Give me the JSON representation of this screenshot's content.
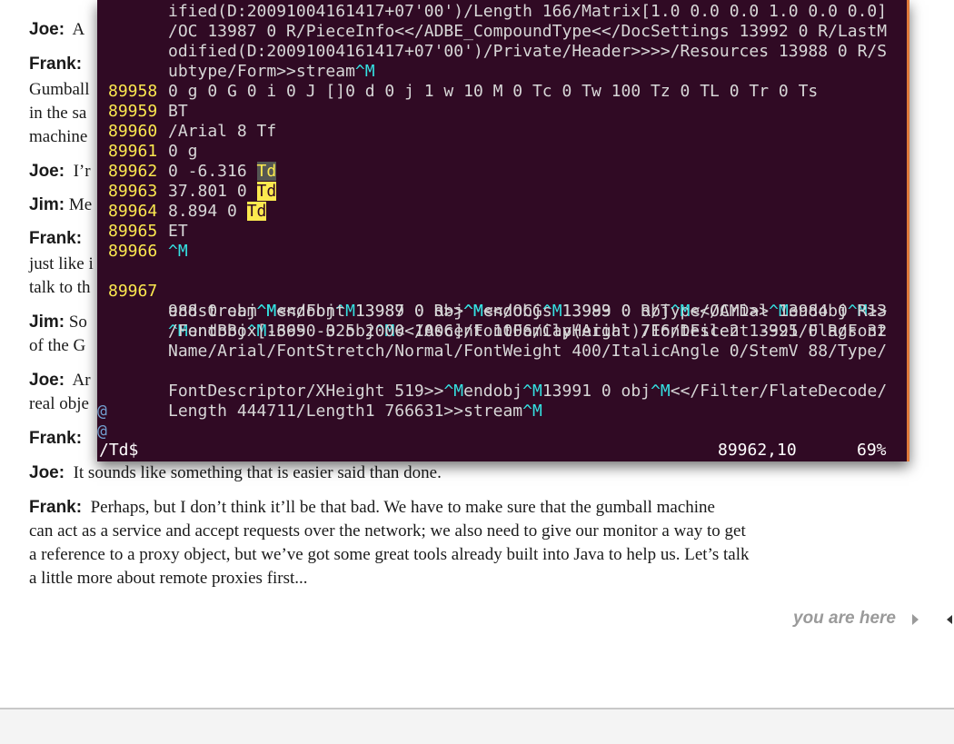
{
  "book": {
    "paragraphs": [
      {
        "speaker": "Joe",
        "sep": ":",
        "line1": "A"
      },
      {
        "speaker": "Frank",
        "sep": ":",
        "line1": "",
        "lines": [
          "Gumball",
          "in the sa",
          "machine"
        ]
      },
      {
        "speaker": "Joe",
        "sep": ":",
        "line1": "I’r"
      },
      {
        "speaker": "Jim",
        "sep": ":",
        "line1": "Me"
      },
      {
        "speaker": "Frank",
        "sep": ":",
        "line1": "",
        "lines": [
          "just like i",
          "talk to th"
        ]
      },
      {
        "speaker": "Jim:",
        "sep": "",
        "line1": "So",
        "lines": [
          "of the G"
        ]
      },
      {
        "speaker": "Joe",
        "sep": ":",
        "line1": "Ar",
        "lines": [
          "real obje"
        ]
      },
      {
        "speaker": "Frank",
        "sep": ":",
        "line1": ""
      },
      {
        "speaker": "Joe",
        "sep": ":",
        "line1": "It sounds like something that is easier said than done."
      },
      {
        "speaker": "Frank",
        "sep": ":",
        "line1": "Perhaps, but I don’t think it’ll be that bad.  We have to make sure that the gumball machine",
        "lines": [
          "can act as a service and accept requests over the network; we also need to give our monitor a way to get",
          "a reference to a proxy object, but we’ve got some great tools already built into Java to help us. Let’s talk",
          "a little more about remote proxies first..."
        ]
      }
    ],
    "footer": {
      "you_are_here": "you are here"
    }
  },
  "terminal": {
    "cont_lines": [
      "ified(D:20091004161417+07'00')/Length 166/Matrix[1.0 0.0 0.0 1.0 0.0 0.0]",
      "/OC 13987 0 R/PieceInfo<</ADBE_CompoundType<</DocSettings 13992 0 R/LastM",
      "odified(D:20091004161417+07'00')/Private/Header>>>>/Resources 13988 0 R/S",
      "ubtype/Form>>stream"
    ],
    "ctrl_m": "^M",
    "lines": [
      {
        "num": "89958",
        "text": "0 g 0 G 0 i 0 J []0 d 0 j 1 w 10 M 0 Tc 0 Tw 100 Tz 0 TL 0 Tr 0 Ts"
      },
      {
        "num": "89959",
        "text": "BT"
      },
      {
        "num": "89960",
        "text": "/Arial 8 Tf"
      },
      {
        "num": "89961",
        "text": "0 g"
      },
      {
        "num": "89962",
        "text": "0 -6.316 ",
        "match": "Td"
      },
      {
        "num": "89963",
        "text": "37.801 0 ",
        "match": "Td"
      },
      {
        "num": "89964",
        "text": "8.894 0 ",
        "match": "Td"
      },
      {
        "num": "89965",
        "text": "ET"
      },
      {
        "num": "89966",
        "text": ""
      },
      {
        "num": "89967",
        "text": "endstream"
      }
    ],
    "l67_rest": [
      "endobj",
      "13987 0 obj",
      "<</OCGs 13993 0 R/Type/OCMD>>",
      "endobj",
      "13",
      "988 0 obj",
      "<</Font 13989 0 R>>",
      "endobj",
      "13989 0 obj",
      "<</Arial 13984 0 R>>",
      "endobj",
      "13990 0 obj",
      "<</Ascent 1006/CapHeight 716/Descent -325/Flags 32",
      "/FontBBox[-665 -325 2000 1006]/FontFamily(Arial)/FontFile2 13991 0 R/Font",
      "Name/Arial/FontStretch/Normal/FontWeight 400/ItalicAngle 0/StemV 88/Type/",
      "FontDescriptor/XHeight 519>>",
      "endobj",
      "13991 0 obj",
      "<</Filter/FlateDecode/",
      "Length 444711/Length1 766631>>stream"
    ],
    "filler": "@",
    "status": {
      "command": "/Td$",
      "position": "89962,10",
      "percent": "69%"
    }
  },
  "colors": {
    "terminal_bg": "#300a24",
    "line_number": "#fce94f",
    "control_char": "#34e2e2",
    "search_match": "#fce94f"
  }
}
